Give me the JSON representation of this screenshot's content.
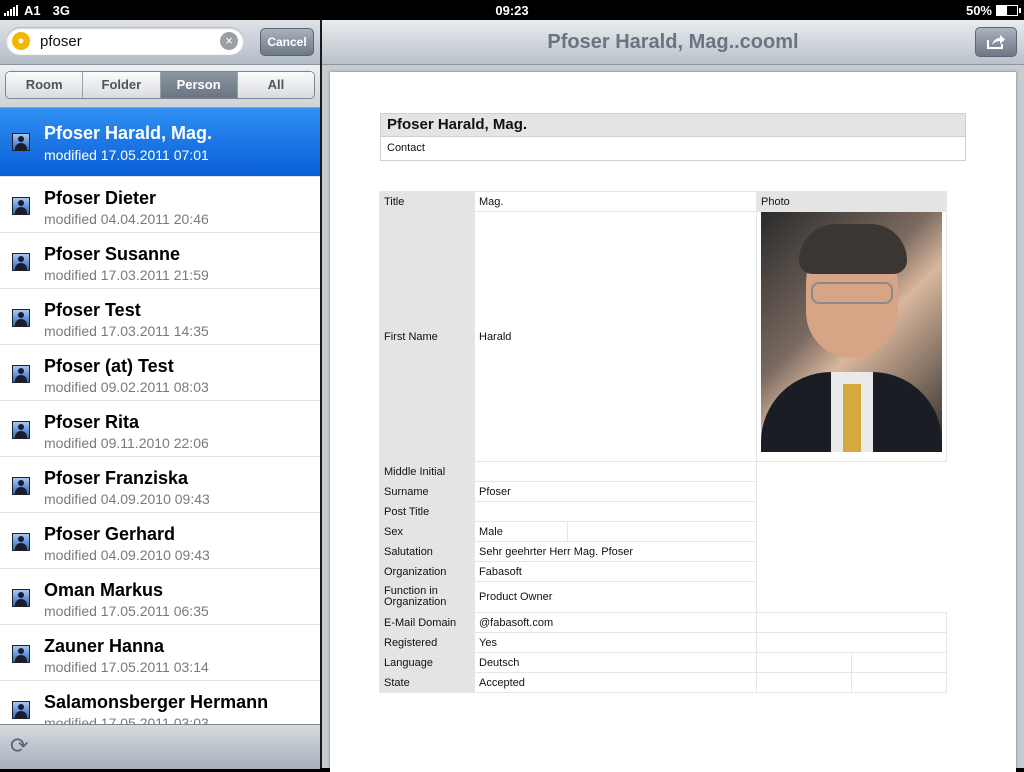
{
  "status": {
    "carrier": "A1",
    "network": "3G",
    "time": "09:23",
    "battery": "50%",
    "battery_level": 0.5
  },
  "search": {
    "value": "pfoser",
    "cancel_label": "Cancel",
    "scope_icon": "fabasoft-icon"
  },
  "segments": [
    {
      "label": "Room",
      "active": false
    },
    {
      "label": "Folder",
      "active": false
    },
    {
      "label": "Person",
      "active": true
    },
    {
      "label": "All",
      "active": false
    }
  ],
  "results": [
    {
      "name": "Pfoser Harald, Mag.",
      "modified": "modified 17.05.2011 07:01",
      "selected": true
    },
    {
      "name": "Pfoser Dieter",
      "modified": "modified 04.04.2011 20:46"
    },
    {
      "name": "Pfoser Susanne",
      "modified": "modified 17.03.2011 21:59"
    },
    {
      "name": "Pfoser Test",
      "modified": "modified 17.03.2011 14:35"
    },
    {
      "name": "Pfoser (at) Test",
      "modified": "modified 09.02.2011 08:03"
    },
    {
      "name": "Pfoser Rita",
      "modified": "modified 09.11.2010 22:06"
    },
    {
      "name": "Pfoser Franziska",
      "modified": "modified 04.09.2010 09:43"
    },
    {
      "name": "Pfoser Gerhard",
      "modified": "modified 04.09.2010 09:43"
    },
    {
      "name": "Oman Markus",
      "modified": "modified 17.05.2011 06:35"
    },
    {
      "name": "Zauner Hanna",
      "modified": "modified 17.05.2011 03:14"
    },
    {
      "name": "Salamonsberger Hermann",
      "modified": "modified 17.05.2011 03:03"
    }
  ],
  "detail": {
    "nav_title": "Pfoser Harald, Mag..cooml",
    "heading": "Pfoser Harald, Mag.",
    "subheading": "Contact",
    "photo_label": "Photo",
    "fields": {
      "title": {
        "label": "Title",
        "value": "Mag."
      },
      "first_name": {
        "label": "First Name",
        "value": "Harald"
      },
      "middle_initial": {
        "label": "Middle Initial",
        "value": ""
      },
      "surname": {
        "label": "Surname",
        "value": "Pfoser"
      },
      "post_title": {
        "label": "Post Title",
        "value": ""
      },
      "sex": {
        "label": "Sex",
        "value": "Male"
      },
      "salutation": {
        "label": "Salutation",
        "value": "Sehr geehrter Herr Mag. Pfoser"
      },
      "organization": {
        "label": "Organization",
        "value": "Fabasoft"
      },
      "function": {
        "label": "Function in Organization",
        "value": "Product Owner"
      },
      "email_domain": {
        "label": "E-Mail Domain",
        "value": "@fabasoft.com"
      },
      "registered": {
        "label": "Registered",
        "value": "Yes"
      },
      "language": {
        "label": "Language",
        "value": "Deutsch"
      },
      "state": {
        "label": "State",
        "value": "Accepted"
      }
    }
  },
  "colors": {
    "selection": "#1a73e8",
    "label_bg": "#e4e4e4"
  }
}
